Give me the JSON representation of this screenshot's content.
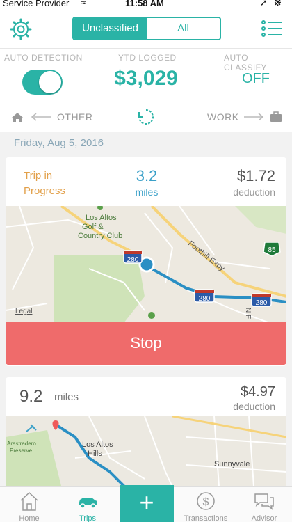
{
  "status_bar": {
    "carrier": "Service Provider",
    "time": "11:58 AM"
  },
  "header": {
    "filter_tabs": [
      {
        "label": "Unclassified",
        "active": true
      },
      {
        "label": "All",
        "active": false
      }
    ]
  },
  "stats": {
    "auto_detection_label": "AUTO DETECTION",
    "auto_detection_on": true,
    "ytd_label": "YTD LOGGED",
    "ytd_value": "$3,029",
    "auto_classify_label": "AUTO CLASSIFY",
    "auto_classify_value": "OFF"
  },
  "swipe_hint": {
    "left_label": "OTHER",
    "right_label": "WORK"
  },
  "date": "Friday, Aug 5, 2016",
  "current_trip": {
    "status": "Trip in Progress",
    "miles": "3.2",
    "miles_unit": "miles",
    "deduction": "$1.72",
    "deduction_label": "deduction",
    "map_labels": {
      "golf": "Los Altos Golf & Country Club",
      "expressway": "Foothill Expy",
      "legal": "Legal",
      "shield_280": "280",
      "shield_85": "85",
      "shield_280b": "280",
      "shield_280c": "280",
      "street": "N F"
    },
    "stop_label": "Stop"
  },
  "previous_trip": {
    "miles": "9.2",
    "miles_unit": "miles",
    "deduction": "$4.97",
    "deduction_label": "deduction",
    "map_labels": {
      "hills": "Los Altos Hills",
      "city": "Sunnyvale",
      "preserve": "Arastradero Preserve"
    }
  },
  "tabbar": {
    "tabs": [
      {
        "label": "Home",
        "icon": "house-icon",
        "active": false
      },
      {
        "label": "Trips",
        "icon": "car-icon",
        "active": true
      },
      {
        "label": "Transactions",
        "icon": "dollar-icon",
        "active": false
      },
      {
        "label": "Advisor",
        "icon": "chat-icon",
        "active": false
      }
    ],
    "add_label": "+"
  },
  "colors": {
    "accent": "#2ab3a6",
    "stop": "#ef6b6b",
    "miles": "#3aa0c8",
    "in_progress": "#e2a04a"
  }
}
